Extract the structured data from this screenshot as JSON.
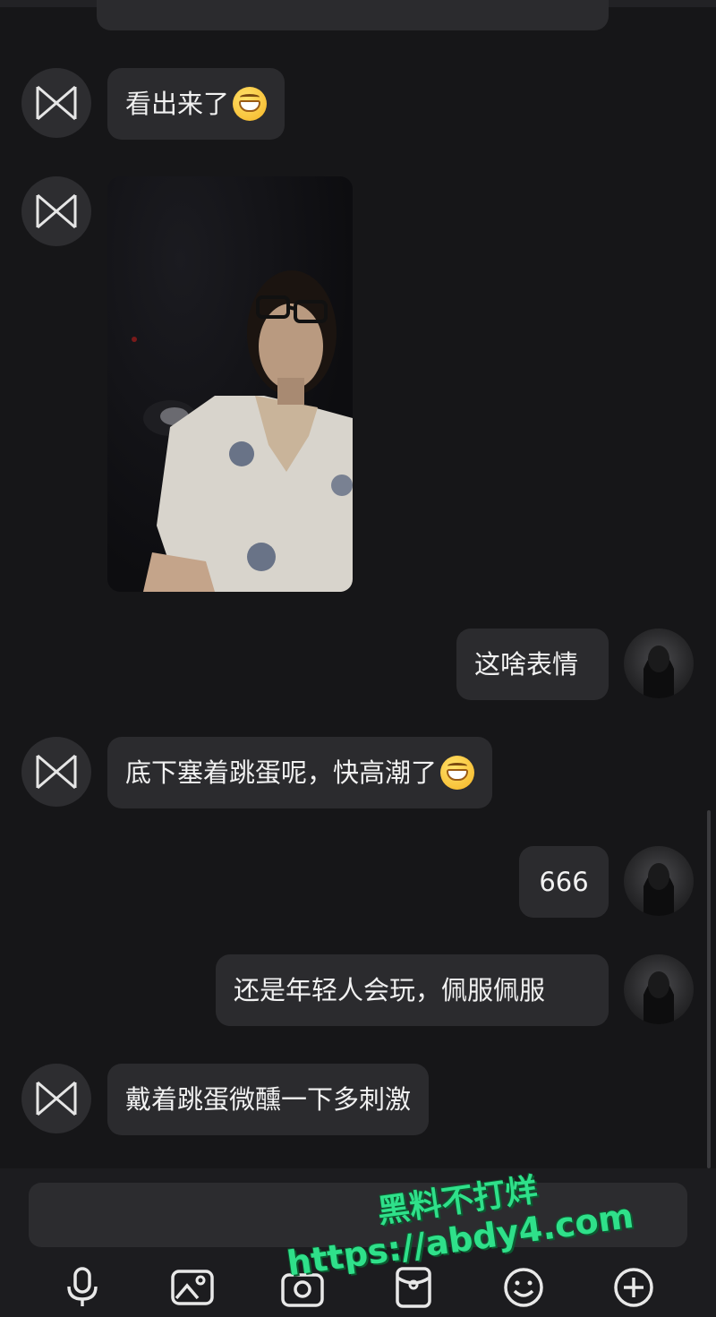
{
  "messages": [
    {
      "side": "left",
      "text": "看出来了",
      "emoji": "grinning-face"
    },
    {
      "side": "left",
      "type": "image",
      "alt": "photo"
    },
    {
      "side": "right",
      "text": "这啥表情"
    },
    {
      "side": "left",
      "text": "底下塞着跳蛋呢，快高潮了",
      "emoji": "grinning-face"
    },
    {
      "side": "right",
      "text": "666"
    },
    {
      "side": "right",
      "text": "还是年轻人会玩，佩服佩服"
    },
    {
      "side": "left",
      "text": "戴着跳蛋微醺一下多刺激"
    }
  ],
  "input": {
    "placeholder": ""
  },
  "toolbar": {
    "icons": [
      "microphone-icon",
      "image-icon",
      "camera-icon",
      "red-packet-icon",
      "emoji-icon",
      "plus-icon"
    ]
  },
  "watermark": {
    "line1": "黑料不打烊",
    "line2": "https://abdy4.com"
  },
  "colors": {
    "background": "#161618",
    "bubble": "#2b2b2e",
    "watermark": "#2fe08a"
  }
}
